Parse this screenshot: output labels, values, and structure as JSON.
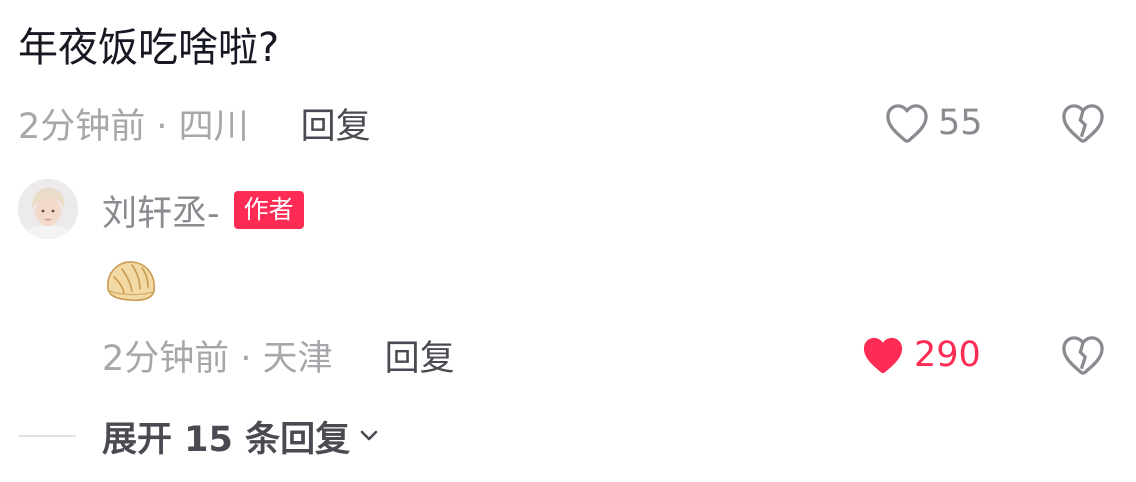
{
  "main_comment": {
    "text": "年夜饭吃啥啦?",
    "time_location": "2分钟前 · 四川",
    "reply_label": "回复",
    "like_count": "55",
    "liked": false
  },
  "reply": {
    "author_name": "刘轩丞-",
    "author_badge": "作者",
    "content_emoji": "dumpling",
    "time_location": "2分钟前 · 天津",
    "reply_label": "回复",
    "like_count": "290",
    "liked": true
  },
  "expand": {
    "label": "展开 15 条回复"
  },
  "colors": {
    "accent": "#fe2c55",
    "meta_grey": "#a7a7ab",
    "text_dark": "#161823"
  },
  "icons": {
    "like_outline": "heart-outline-icon",
    "like_filled": "heart-filled-icon",
    "dislike": "broken-heart-icon",
    "expand": "chevron-down-icon"
  }
}
